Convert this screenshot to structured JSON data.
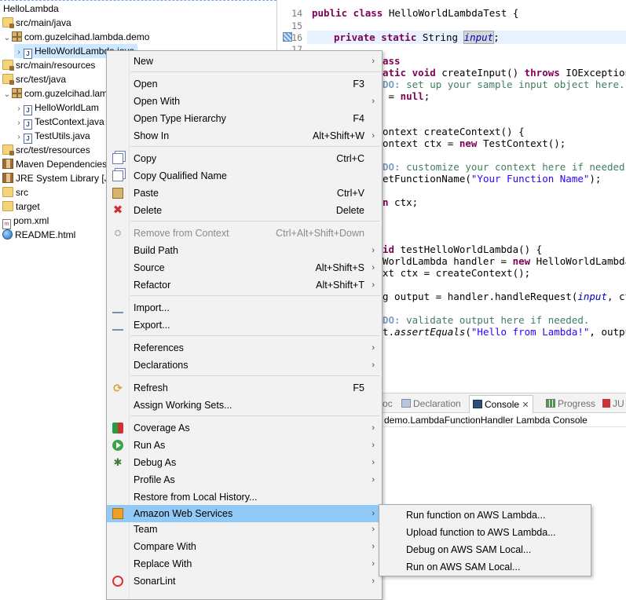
{
  "explorer": {
    "rows": [
      {
        "label": "HelloLambda",
        "icon": "project-icon"
      },
      {
        "label": "src/main/java",
        "icon": "source-folder-icon"
      },
      {
        "label": "com.guzelcihad.lambda.demo",
        "icon": "package-icon"
      },
      {
        "label": "HelloWorldLambda.java",
        "icon": "java-file-icon"
      },
      {
        "label": "src/main/resources",
        "icon": "source-folder-icon"
      },
      {
        "label": "src/test/java",
        "icon": "source-folder-icon"
      },
      {
        "label": "com.guzelcihad.lam",
        "icon": "package-icon"
      },
      {
        "label": "HelloWorldLam",
        "icon": "java-file-icon"
      },
      {
        "label": "TestContext.java",
        "icon": "java-file-icon"
      },
      {
        "label": "TestUtils.java",
        "icon": "java-file-icon"
      },
      {
        "label": "src/test/resources",
        "icon": "source-folder-icon"
      },
      {
        "label": "Maven Dependencies",
        "icon": "library-icon"
      },
      {
        "label": "JRE System Library [Jav",
        "icon": "library-icon"
      },
      {
        "label": "src",
        "icon": "folder-icon"
      },
      {
        "label": "target",
        "icon": "folder-icon"
      },
      {
        "label": "pom.xml",
        "icon": "xml-file-icon"
      },
      {
        "label": "README.html",
        "icon": "html-file-icon"
      }
    ]
  },
  "editor": {
    "line_numbers": [
      "14",
      "15",
      "16",
      "17"
    ],
    "line14": {
      "kw": "public class",
      "rest": " HelloWorldLambdaTest {"
    },
    "line16": {
      "kw": "private static",
      "type": " String ",
      "field": "input",
      "end": ";"
    },
    "frag1": "ass",
    "frag2": {
      "kw1": "atic void",
      "mid": " createInput() ",
      "kw2": "throws",
      "end": " IOException {"
    },
    "frag3": {
      "todo": "DO:",
      "cmt": " set up your sample input object here."
    },
    "frag4": {
      "pre": " = ",
      "kw": "null",
      "end": ";"
    },
    "frag5": "ontext createContext() {",
    "frag6": {
      "pre": "ontext ctx = ",
      "kw": "new",
      "end": " TestContext();"
    },
    "frag7": {
      "todo": "DO:",
      "cmt": " customize your context here if needed."
    },
    "frag8": {
      "pre": "etFunctionName(",
      "str": "\"Your Function Name\"",
      "end": ");"
    },
    "frag9": {
      "kw": "n",
      "end": " ctx;"
    },
    "frag10": {
      "kw": "id",
      "end": " testHelloWorldLambda() {"
    },
    "frag11": {
      "pre": "WorldLambda handler = ",
      "kw": "new",
      "end": " HelloWorldLambda()"
    },
    "frag12": "xt ctx = createContext();",
    "frag13": {
      "pre": "g output = handler.handleRequest(",
      "field": "input",
      "end": ", ctx)"
    },
    "frag14": {
      "todo": "DO:",
      "cmt": " validate output here if needed."
    },
    "frag15": {
      "pre": "t.",
      "italic": "assertEquals",
      "mid": "(",
      "str": "\"Hello from Lambda!\"",
      "end": ", output)"
    }
  },
  "views": {
    "tabs": [
      {
        "label": "oc"
      },
      {
        "label": "Declaration"
      },
      {
        "label": "Console"
      },
      {
        "label": "Progress"
      },
      {
        "label": "JU"
      }
    ],
    "console_title": "demo.LambdaFunctionHandler Lambda Console"
  },
  "context_menu": {
    "items": [
      {
        "label": "New",
        "accel": "",
        "submenu": true
      },
      {
        "label": "Open",
        "accel": "F3"
      },
      {
        "label": "Open With",
        "accel": "",
        "submenu": true
      },
      {
        "label": "Open Type Hierarchy",
        "accel": "F4"
      },
      {
        "label": "Show In",
        "accel": "Alt+Shift+W",
        "submenu": true
      },
      {
        "label": "Copy",
        "accel": "Ctrl+C"
      },
      {
        "label": "Copy Qualified Name",
        "accel": ""
      },
      {
        "label": "Paste",
        "accel": "Ctrl+V"
      },
      {
        "label": "Delete",
        "accel": "Delete"
      },
      {
        "label": "Remove from Context",
        "accel": "Ctrl+Alt+Shift+Down",
        "disabled": true
      },
      {
        "label": "Build Path",
        "accel": "",
        "submenu": true
      },
      {
        "label": "Source",
        "accel": "Alt+Shift+S",
        "submenu": true
      },
      {
        "label": "Refactor",
        "accel": "Alt+Shift+T",
        "submenu": true
      },
      {
        "label": "Import...",
        "accel": ""
      },
      {
        "label": "Export...",
        "accel": ""
      },
      {
        "label": "References",
        "accel": "",
        "submenu": true
      },
      {
        "label": "Declarations",
        "accel": "",
        "submenu": true
      },
      {
        "label": "Refresh",
        "accel": "F5"
      },
      {
        "label": "Assign Working Sets...",
        "accel": ""
      },
      {
        "label": "Coverage As",
        "accel": "",
        "submenu": true
      },
      {
        "label": "Run As",
        "accel": "",
        "submenu": true
      },
      {
        "label": "Debug As",
        "accel": "",
        "submenu": true
      },
      {
        "label": "Profile As",
        "accel": "",
        "submenu": true
      },
      {
        "label": "Restore from Local History...",
        "accel": ""
      },
      {
        "label": "Amazon Web Services",
        "accel": "",
        "submenu": true,
        "highlighted": true
      },
      {
        "label": "Team",
        "accel": "",
        "submenu": true
      },
      {
        "label": "Compare With",
        "accel": "",
        "submenu": true
      },
      {
        "label": "Replace With",
        "accel": "",
        "submenu": true
      },
      {
        "label": "SonarLint",
        "accel": "",
        "submenu": true
      }
    ],
    "submenu_arrow": "›"
  },
  "aws_submenu": {
    "items": [
      {
        "label": "Run function on AWS Lambda..."
      },
      {
        "label": "Upload function to AWS Lambda..."
      },
      {
        "label": "Debug on AWS SAM Local..."
      },
      {
        "label": "Run on AWS SAM Local..."
      }
    ]
  },
  "colors": {
    "highlight": "#91c9f7",
    "menu_bg": "#f2f2f2",
    "keyword": "#7f0055",
    "comment": "#3f7f5f",
    "string": "#2a00ff"
  }
}
